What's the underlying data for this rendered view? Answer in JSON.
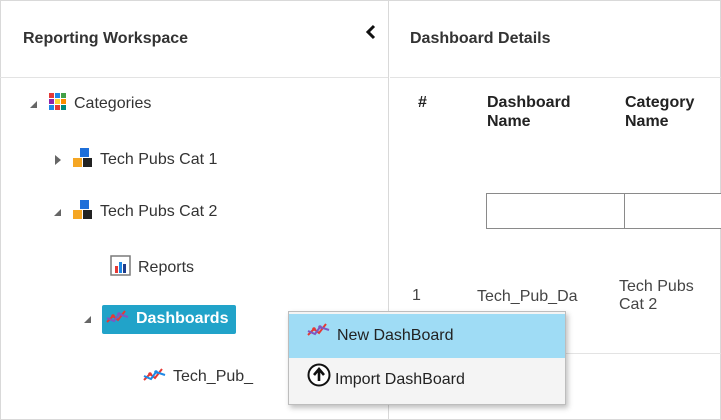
{
  "left_panel": {
    "title": "Reporting Workspace",
    "tree": {
      "root": "Categories",
      "cat1": "Tech Pubs Cat 1",
      "cat2": "Tech Pubs Cat 2",
      "reports": "Reports",
      "dashboards": "Dashboards",
      "dashboard_item": "Tech_Pub_"
    }
  },
  "right_panel": {
    "title": "Dashboard Details",
    "columns": [
      "#",
      "Dashboard Name",
      "Category Name"
    ],
    "rows": [
      {
        "index": "1",
        "dashboard_name": "Tech_Pub_Da",
        "category_name": "Tech Pubs Cat 2"
      }
    ]
  },
  "context_menu": {
    "items": [
      {
        "label": "New DashBoard",
        "icon": "dashboard-icon"
      },
      {
        "label": "Import DashBoard",
        "icon": "import-arrow-icon"
      }
    ]
  },
  "colors": {
    "selected_bg": "#21a3c9",
    "menu_highlight": "#9fdcf5",
    "menu_bg": "#f4f4f4"
  }
}
